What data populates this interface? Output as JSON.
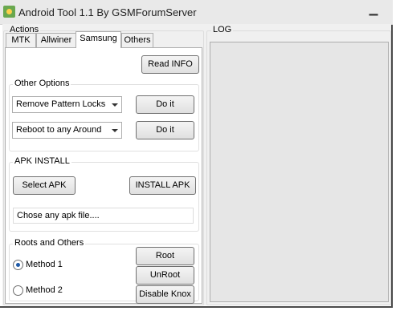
{
  "window": {
    "title": "Android Tool 1.1 By GSMForumServer",
    "minimize_label": "▁"
  },
  "actions": {
    "legend": "Actions",
    "tabs": [
      {
        "label": "MTK"
      },
      {
        "label": "Allwiner"
      },
      {
        "label": "Samsung"
      },
      {
        "label": "Others"
      }
    ],
    "read_info_label": "Read INFO",
    "other_options": {
      "legend": "Other Options",
      "combo1_value": "Remove Pattern Locks",
      "combo2_value": "Reboot to any Around",
      "doit1_label": "Do it",
      "doit2_label": "Do it"
    },
    "apk_install": {
      "legend": "APK INSTALL",
      "select_label": "Select APK",
      "install_label": "INSTALL APK",
      "file_text": "Chose any apk file...."
    },
    "roots": {
      "legend": "Roots and Others",
      "method1_label": "Method 1",
      "method2_label": "Method 2",
      "root_label": "Root",
      "unroot_label": "UnRoot",
      "disable_knox_label": "Disable Knox"
    }
  },
  "log": {
    "legend": "LOG"
  }
}
